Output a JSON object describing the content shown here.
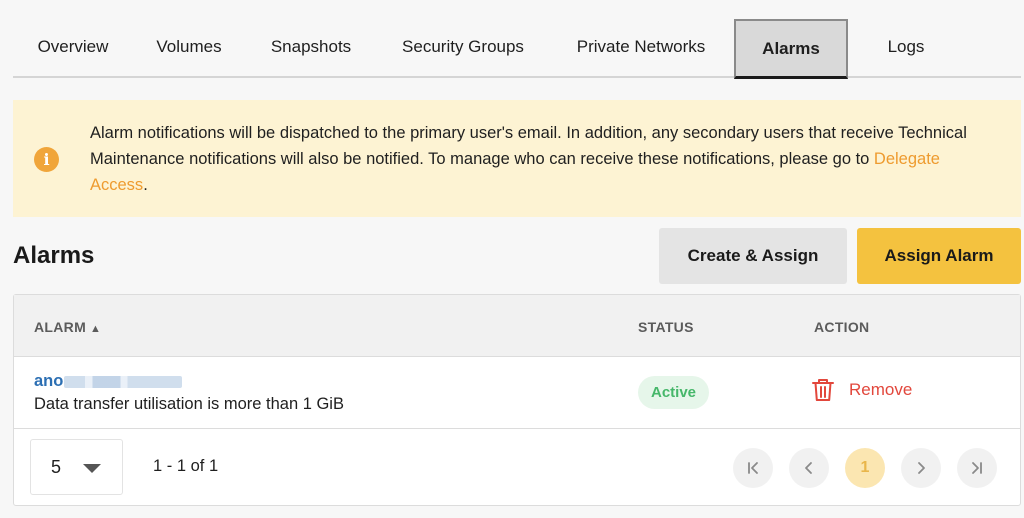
{
  "tabs": [
    {
      "label": "Overview"
    },
    {
      "label": "Volumes"
    },
    {
      "label": "Snapshots"
    },
    {
      "label": "Security Groups"
    },
    {
      "label": "Private Networks"
    },
    {
      "label": "Alarms",
      "active": true
    },
    {
      "label": "Logs"
    }
  ],
  "notice": {
    "icon": "info-icon",
    "text": "Alarm notifications will be dispatched to the primary user's email. In addition, any secondary users that receive Technical Maintenance notifications will also be notified. To manage who can receive these notifications, please go to ",
    "link": "Delegate Access",
    "end": ".",
    "icon_color": "#f0a53a",
    "background": "#fdf3d3"
  },
  "section": {
    "title": "Alarms",
    "create_label": "Create & Assign",
    "assign_label": "Assign Alarm",
    "assign_color": "#f4c23f"
  },
  "table": {
    "columns": {
      "alarm": "ALARM",
      "status": "STATUS",
      "action": "ACTION"
    },
    "rows": [
      {
        "name": "ano",
        "description": "Data transfer utilisation is more than 1 GiB",
        "status": "Active",
        "action": "Remove"
      }
    ]
  },
  "pagination": {
    "page_size": "5",
    "range": "1 - 1 of 1",
    "current_page": "1"
  }
}
